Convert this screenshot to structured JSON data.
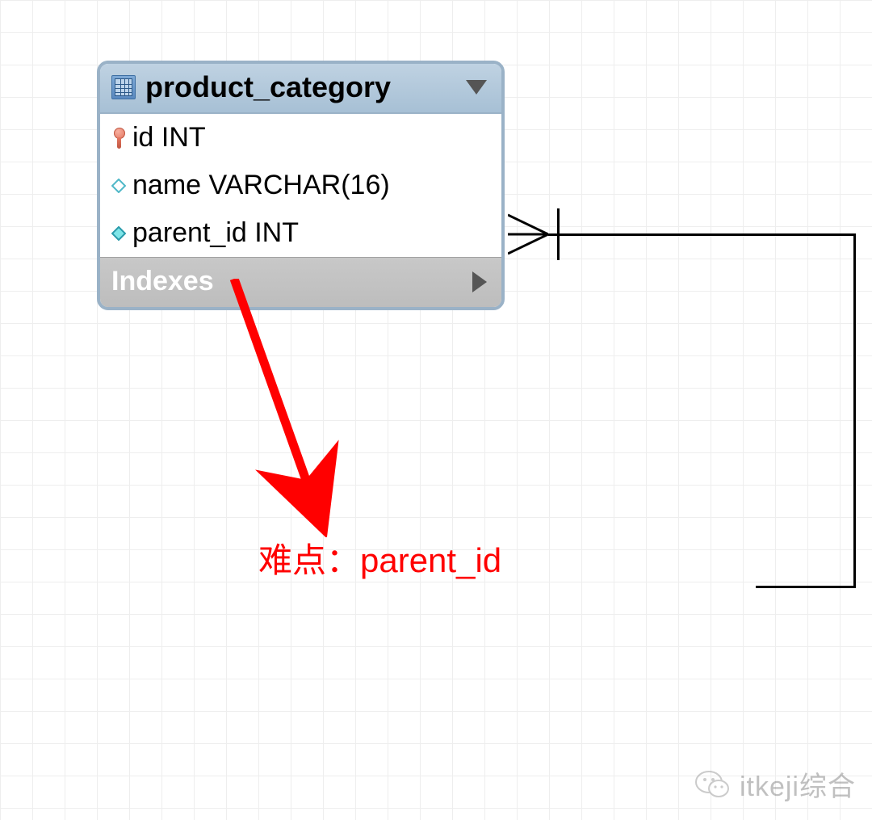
{
  "table": {
    "name": "product_category",
    "columns": [
      {
        "kind": "pk",
        "label": "id INT"
      },
      {
        "kind": "col",
        "filled": false,
        "label": "name VARCHAR(16)"
      },
      {
        "kind": "col",
        "filled": true,
        "label": "parent_id INT"
      }
    ],
    "footer_label": "Indexes"
  },
  "annotation": {
    "text": "难点：parent_id"
  },
  "watermark": {
    "label": "itkeji综合"
  },
  "colors": {
    "header_bg": "#a7c0d5",
    "border": "#9ab2c7",
    "annotation": "#ff0000",
    "footer_bg": "#bdbdbd"
  }
}
